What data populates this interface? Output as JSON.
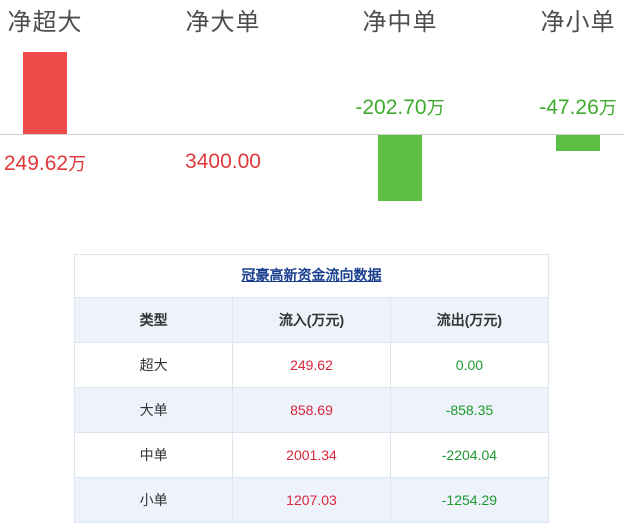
{
  "chart_data": {
    "type": "bar",
    "categories": [
      "净超大",
      "净大单",
      "净中单",
      "净小单"
    ],
    "values": [
      249.62,
      3400.0,
      -202.7,
      -47.26
    ],
    "value_labels": [
      "249.62",
      "3400.00",
      "-202.70",
      "-47.26"
    ],
    "value_units": [
      "万",
      "",
      "万",
      "万"
    ],
    "positive_color": "#ef4b4b",
    "negative_color": "#5cbf46"
  },
  "table": {
    "title": "冠豪高新资金流向数据",
    "headers": [
      "类型",
      "流入(万元)",
      "流出(万元)"
    ],
    "rows": [
      [
        "超大",
        "249.62",
        "0.00"
      ],
      [
        "大单",
        "858.69",
        "-858.35"
      ],
      [
        "中单",
        "2001.34",
        "-2204.04"
      ],
      [
        "小单",
        "1207.03",
        "-1254.29"
      ]
    ]
  }
}
